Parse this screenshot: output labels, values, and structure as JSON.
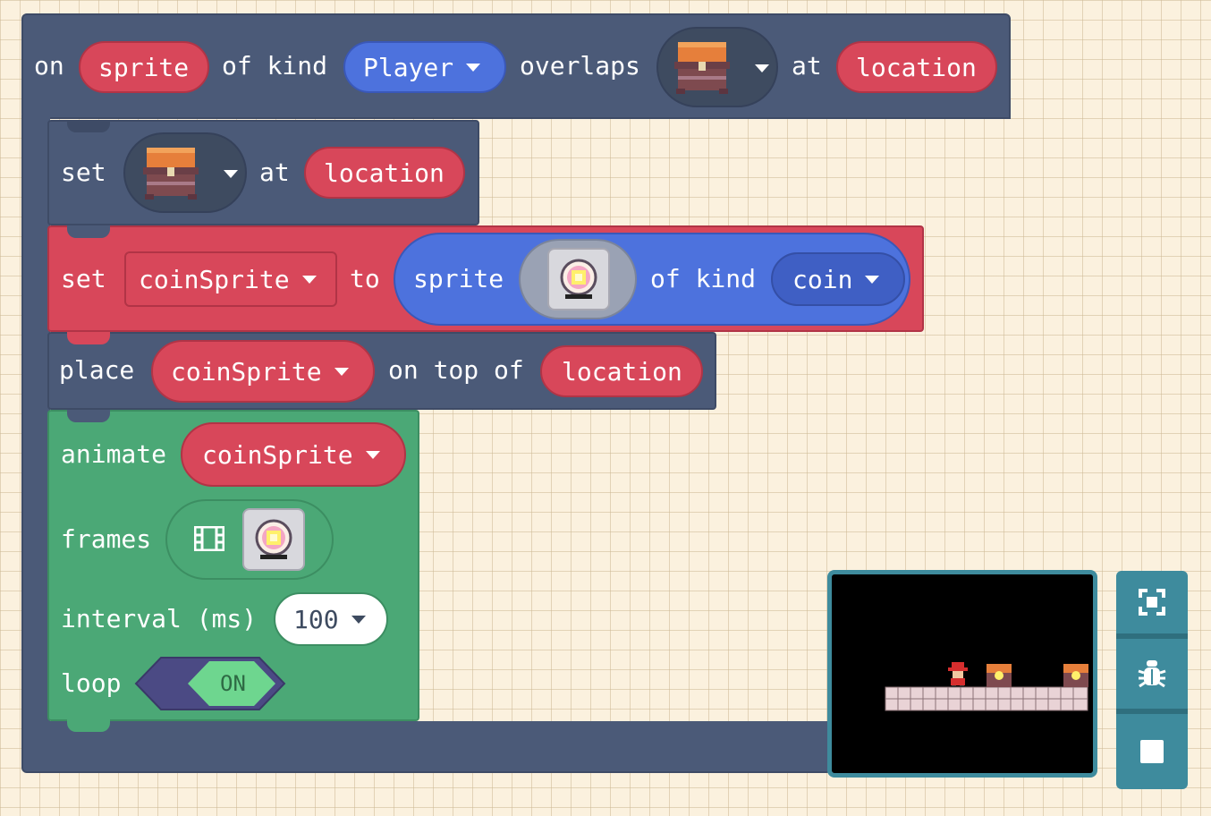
{
  "event_block": {
    "on": "on",
    "sprite": "sprite",
    "of_kind": "of kind",
    "kind": "Player",
    "overlaps": "overlaps",
    "at": "at",
    "location": "location",
    "tile_icon": "treasure-chest-icon"
  },
  "set_tile_block": {
    "set": "set",
    "tile_icon": "treasure-chest-icon",
    "at": "at",
    "location": "location"
  },
  "set_var_block": {
    "set": "set",
    "variable": "coinSprite",
    "to": "to",
    "sprite": "sprite",
    "image_icon": "coin-icon",
    "of_kind": "of kind",
    "kind": "coin"
  },
  "place_block": {
    "place": "place",
    "variable": "coinSprite",
    "on_top_of": "on top of",
    "location": "location"
  },
  "animate_block": {
    "animate": "animate",
    "variable": "coinSprite",
    "frames": "frames",
    "frames_icon": "film-icon",
    "interval_label": "interval (ms)",
    "interval_value": "100",
    "loop": "loop",
    "loop_toggle": "ON"
  },
  "sidebar": {
    "buttons": [
      "fullscreen-icon",
      "debug-bug-icon",
      "stop-icon"
    ]
  },
  "colors": {
    "event_block": "#4b5a78",
    "sprite_red": "#d8475a",
    "sprite_blue": "#4d72dd",
    "animation_green": "#4ba876",
    "simulator_border": "#3e8b9d"
  }
}
